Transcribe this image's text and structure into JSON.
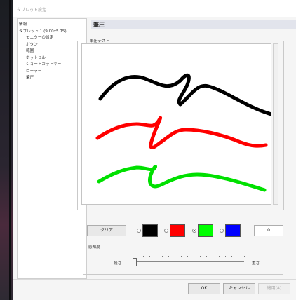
{
  "window": {
    "title": "タブレット設定"
  },
  "tree": {
    "items": [
      {
        "label": "情報",
        "level": 0
      },
      {
        "label": "タブレット 1 (9.00x5.75)",
        "level": 0
      },
      {
        "label": "モニターの設定",
        "level": 1
      },
      {
        "label": "ボタン",
        "level": 1
      },
      {
        "label": "範囲",
        "level": 1
      },
      {
        "label": "ホットセル",
        "level": 1
      },
      {
        "label": "ショートカットキー",
        "level": 1
      },
      {
        "label": "ローラー",
        "level": 1
      },
      {
        "label": "筆圧",
        "level": 1
      }
    ]
  },
  "panel": {
    "title": "筆圧",
    "test_group_label": "筆圧テスト"
  },
  "strokes": [
    {
      "color": "#000000",
      "name": "black-stroke"
    },
    {
      "color": "#ff0000",
      "name": "red-stroke"
    },
    {
      "color": "#00e000",
      "name": "green-stroke"
    }
  ],
  "controls": {
    "clear_label": "クリア",
    "colors": [
      {
        "name": "black",
        "hex": "#000000",
        "selected": false
      },
      {
        "name": "red",
        "hex": "#ff0000",
        "selected": false
      },
      {
        "name": "green",
        "hex": "#00ff00",
        "selected": true
      },
      {
        "name": "blue",
        "hex": "#0000ff",
        "selected": false
      }
    ],
    "value": "0"
  },
  "sensitivity": {
    "group_label": "感知度",
    "light_label": "軽さ",
    "heavy_label": "重さ"
  },
  "footer": {
    "ok": "OK",
    "cancel": "キャンセル",
    "apply": "適用(A)"
  }
}
